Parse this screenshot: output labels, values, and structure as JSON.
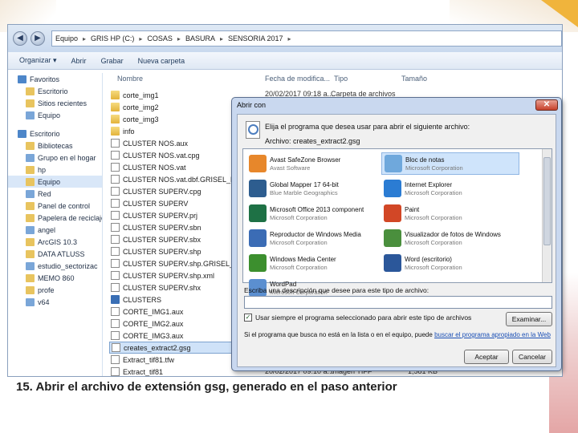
{
  "caption": "15. Abrir el archivo de extensión gsg, generado en el paso anterior",
  "explorer": {
    "breadcrumb": [
      "Equipo",
      "GRIS HP (C:)",
      "COSAS",
      "BASURA",
      "SENSORIA 2017"
    ],
    "toolbar": [
      "Organizar ▾",
      "Abrir",
      "Grabar",
      "Nueva carpeta"
    ],
    "columns": {
      "name": "Nombre",
      "date": "Fecha de modifica...",
      "type": "Tipo",
      "size": "Tamaño"
    },
    "nav": [
      {
        "label": "Favoritos",
        "top": true
      },
      {
        "label": "Escritorio"
      },
      {
        "label": "Sitios recientes"
      },
      {
        "label": "Equipo"
      },
      {
        "label": "Escritorio",
        "top": true
      },
      {
        "label": "Bibliotecas"
      },
      {
        "label": "Grupo en el hogar"
      },
      {
        "label": "hp"
      },
      {
        "label": "Equipo",
        "sel": true
      },
      {
        "label": "Red"
      },
      {
        "label": "Panel de control"
      },
      {
        "label": "Papelera de reciclaje"
      },
      {
        "label": "angel"
      },
      {
        "label": "ArcGIS 10.3"
      },
      {
        "label": "DATA ATLUSS"
      },
      {
        "label": "estudio_sectorizac"
      },
      {
        "label": "MEMO 860"
      },
      {
        "label": "profe"
      },
      {
        "label": "v64"
      }
    ],
    "files": [
      {
        "name": "corte_img1",
        "kind": "folder"
      },
      {
        "name": "corte_img2",
        "kind": "folder"
      },
      {
        "name": "corte_img3",
        "kind": "folder"
      },
      {
        "name": "info",
        "kind": "folder"
      },
      {
        "name": "CLUSTER NOS.aux",
        "kind": "doc"
      },
      {
        "name": "CLUSTER NOS.vat.cpg",
        "kind": "doc"
      },
      {
        "name": "CLUSTER NOS.vat",
        "kind": "doc"
      },
      {
        "name": "CLUSTER NOS.vat.dbf.GRISEL_HP.2380",
        "kind": "doc"
      },
      {
        "name": "CLUSTER SUPERV.cpg",
        "kind": "doc"
      },
      {
        "name": "CLUSTER SUPERV",
        "kind": "doc"
      },
      {
        "name": "CLUSTER SUPERV.prj",
        "kind": "doc"
      },
      {
        "name": "CLUSTER SUPERV.sbn",
        "kind": "doc"
      },
      {
        "name": "CLUSTER SUPERV.sbx",
        "kind": "doc"
      },
      {
        "name": "CLUSTER SUPERV.shp",
        "kind": "doc"
      },
      {
        "name": "CLUSTER SUPERV.shp.GRISEL_HP.2380",
        "kind": "doc"
      },
      {
        "name": "CLUSTER SUPERV.shp.xml",
        "kind": "doc"
      },
      {
        "name": "CLUSTER SUPERV.shx",
        "kind": "doc"
      },
      {
        "name": "CLUSTERS",
        "kind": "app"
      },
      {
        "name": "CORTE_IMG1.aux",
        "kind": "doc"
      },
      {
        "name": "CORTE_IMG2.aux",
        "kind": "doc"
      },
      {
        "name": "CORTE_IMG3.aux",
        "kind": "doc"
      },
      {
        "name": "creates_extract2.gsg",
        "kind": "doc",
        "sel": true
      },
      {
        "name": "Extract_tif81.tfw",
        "kind": "doc"
      },
      {
        "name": "Extract_tif81",
        "kind": "doc"
      }
    ],
    "bg_cells": {
      "row1_date": "20/02/2017 09:18 a...",
      "row1_type": "Carpeta de archivos",
      "last_date": "20/02/2017 09:10 a...",
      "last_type": "Imagen TIFF",
      "last_size": "1,581 KB"
    }
  },
  "dialog": {
    "title": "Abrir con",
    "close": "✕",
    "prompt": "Elija el programa que desea usar para abrir el siguiente archivo:",
    "file": "Archivo:    creates_extract2.gsg",
    "programs": [
      {
        "name": "Avast SafeZone Browser",
        "pub": "Avast Software",
        "color": "#e7872b"
      },
      {
        "name": "Bloc de notas",
        "pub": "Microsoft Corporation",
        "color": "#6fa8dc",
        "sel": true
      },
      {
        "name": "Global Mapper 17 64-bit",
        "pub": "Blue Marble Geographics",
        "color": "#2d5d8f"
      },
      {
        "name": "Internet Explorer",
        "pub": "Microsoft Corporation",
        "color": "#2b7cd3"
      },
      {
        "name": "Microsoft Office 2013 component",
        "pub": "Microsoft Corporation",
        "color": "#1e7145"
      },
      {
        "name": "Paint",
        "pub": "Microsoft Corporation",
        "color": "#d24726"
      },
      {
        "name": "Reproductor de Windows Media",
        "pub": "Microsoft Corporation",
        "color": "#3b6cb5"
      },
      {
        "name": "Visualizador de fotos de Windows",
        "pub": "Microsoft Corporation",
        "color": "#4a8f3d"
      },
      {
        "name": "Windows Media Center",
        "pub": "Microsoft Corporation",
        "color": "#3c8f2e"
      },
      {
        "name": "Word (escritorio)",
        "pub": "Microsoft Corporation",
        "color": "#2b579a"
      },
      {
        "name": "WordPad",
        "pub": "Microsoft Corporation",
        "color": "#5b8fd0"
      }
    ],
    "desc_label": "Escriba una descripción que desee para este tipo de archivo:",
    "checkbox": "Usar siempre el programa seleccionado para abrir este tipo de archivos",
    "check_mark": "✓",
    "examine": "Examinar...",
    "note_prefix": "Si el programa que busca no está en la lista o en el equipo, puede",
    "note_link": "buscar el programa apropiado en la Web",
    "accept": "Aceptar",
    "cancel": "Cancelar"
  }
}
